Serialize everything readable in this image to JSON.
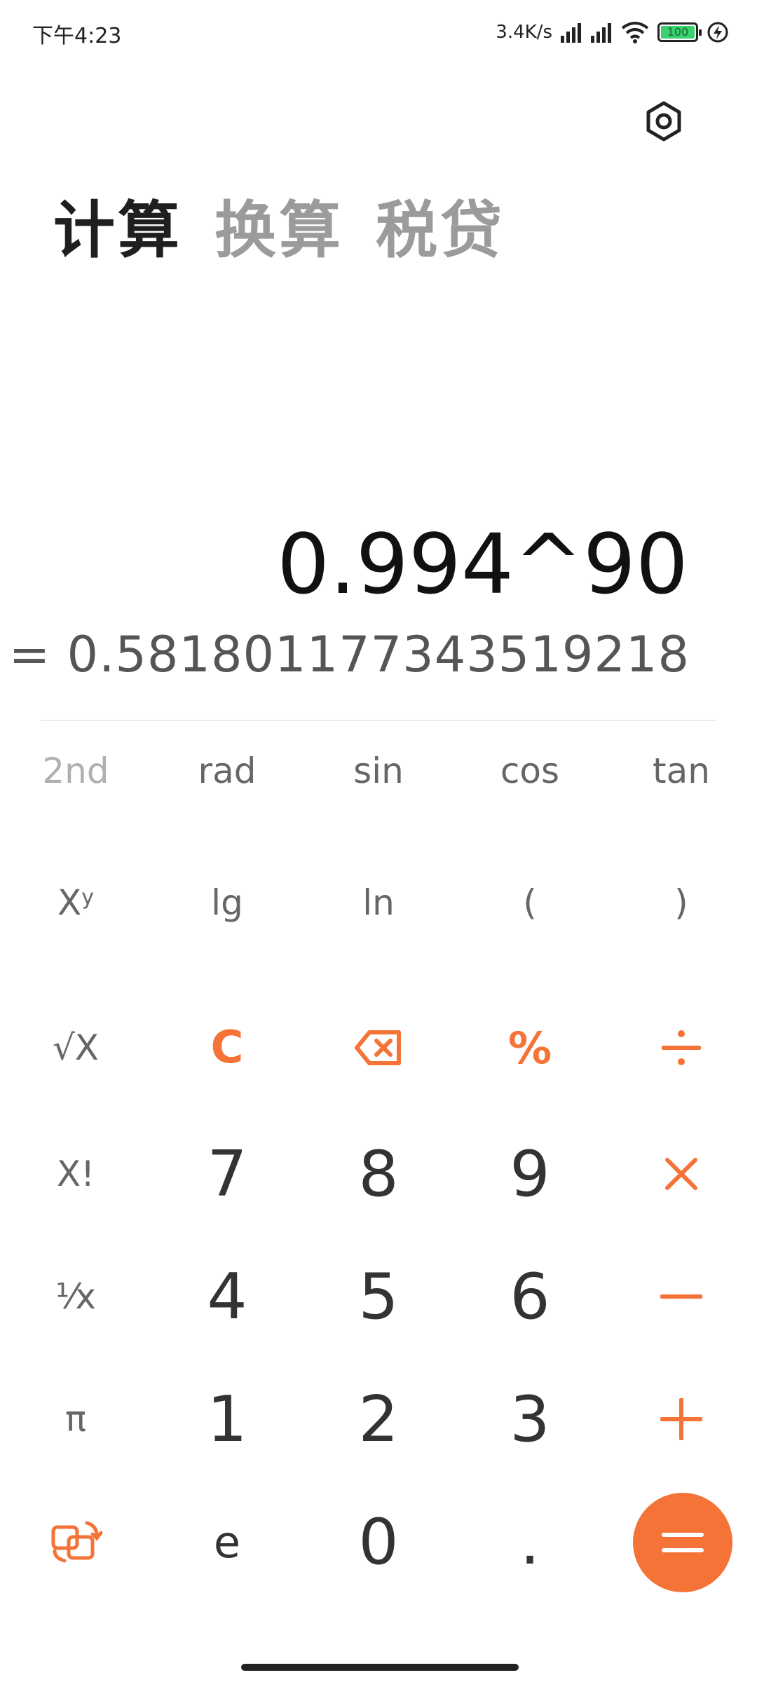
{
  "status_bar": {
    "time": "下午4:23",
    "net_speed": "3.4K/s",
    "battery": "100"
  },
  "tabs": [
    {
      "label": "计算",
      "active": true
    },
    {
      "label": "换算",
      "active": false
    },
    {
      "label": "税贷",
      "active": false
    }
  ],
  "display": {
    "expression": "0.994^90",
    "result": "= 0.58180117734351921​8"
  },
  "keys": {
    "row1": [
      "2nd",
      "rad",
      "sin",
      "cos",
      "tan"
    ],
    "row2": {
      "xy": "X",
      "xy_sup": "y",
      "lg": "lg",
      "ln": "ln",
      "lparen": "(",
      "rparen": ")"
    },
    "row3": {
      "sqrt": "√X",
      "clear": "C",
      "percent": "%"
    },
    "row4": {
      "fact": "X!",
      "d7": "7",
      "d8": "8",
      "d9": "9"
    },
    "row5": {
      "recip": "¹⁄x",
      "d4": "4",
      "d5": "5",
      "d6": "6"
    },
    "row6": {
      "pi": "π",
      "d1": "1",
      "d2": "2",
      "d3": "3"
    },
    "row7": {
      "e": "e",
      "d0": "0",
      "dot": "."
    }
  },
  "colors": {
    "accent": "#f57336",
    "active_tab": "#1f1f1f",
    "inactive_tab": "#9b9b9b"
  }
}
